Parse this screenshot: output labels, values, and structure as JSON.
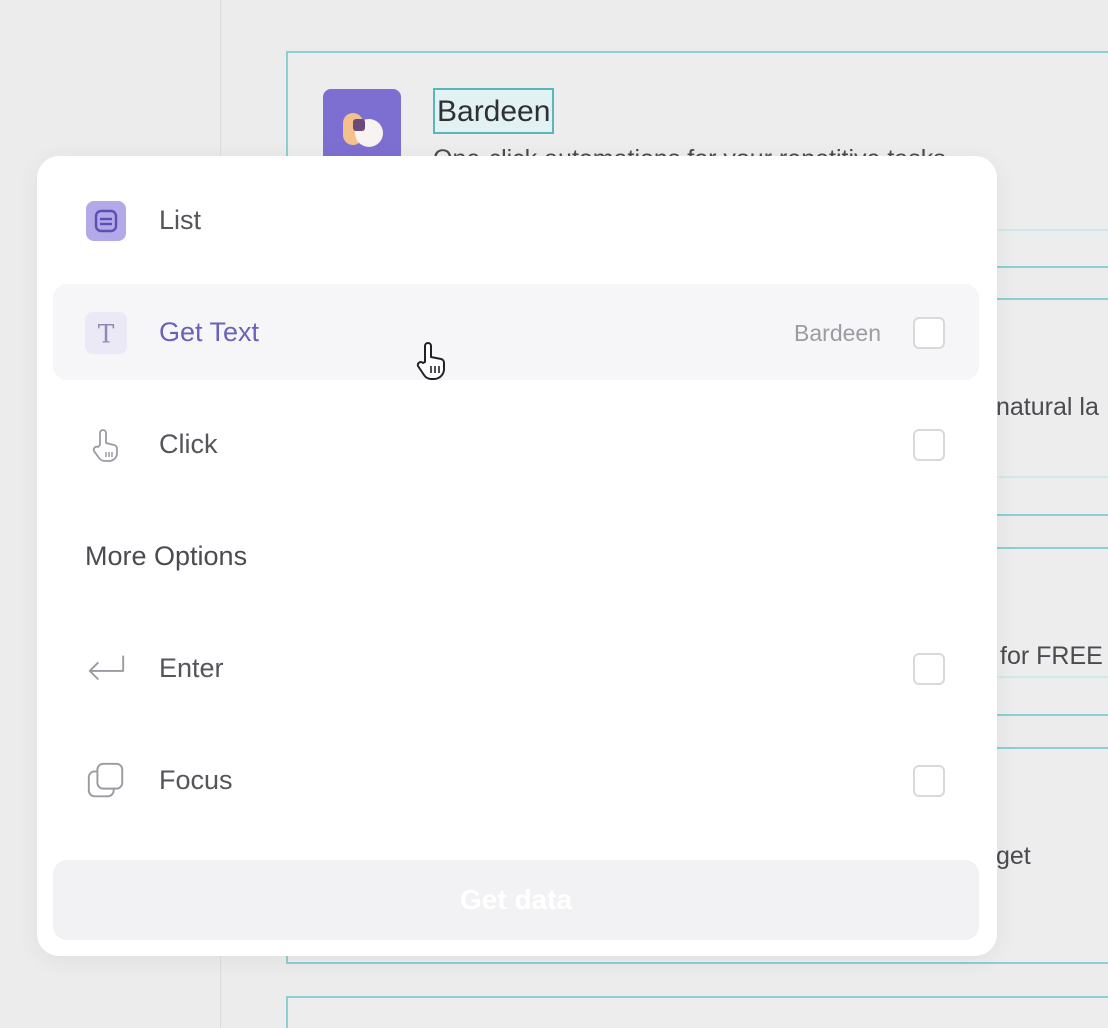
{
  "background": {
    "app_title": "Bardeen",
    "app_subtitle": "One-click automations for your repetitive tasks",
    "card2_snippet": "natural la",
    "card3_snippet": "for FREE",
    "card4_snippet": "get"
  },
  "popup": {
    "items": [
      {
        "icon": "list-icon",
        "label": "List"
      },
      {
        "icon": "text-icon",
        "label": "Get Text",
        "tag": "Bardeen",
        "checked": false
      },
      {
        "icon": "pointer-icon",
        "label": "Click",
        "checked": false
      }
    ],
    "more_options_title": "More Options",
    "more_items": [
      {
        "icon": "enter-icon",
        "label": "Enter",
        "checked": false
      },
      {
        "icon": "focus-icon",
        "label": "Focus",
        "checked": false
      }
    ],
    "get_data_label": "Get data"
  },
  "colors": {
    "accent": "#7d6fd1",
    "highlight_border": "#8ccfd0"
  }
}
